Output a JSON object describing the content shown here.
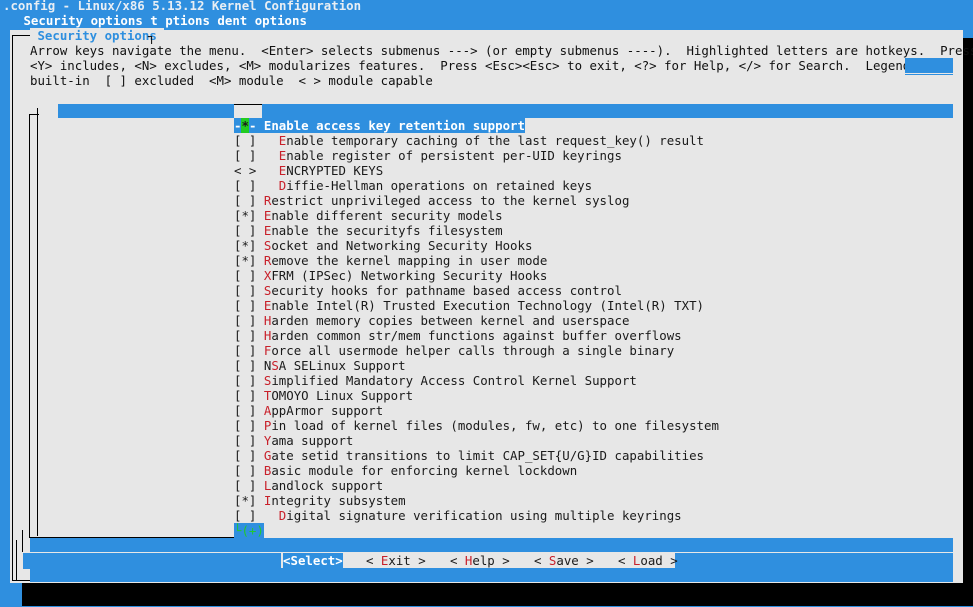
{
  "window": {
    "title": ".config - Linux/x86 5.13.12 Kernel Configuration",
    "breadcrumb": " Security options t ptions dent options"
  },
  "dialog": {
    "title": " Security options ",
    "help_line1": "Arrow keys navigate the menu.  <Enter> selects submenus ---> (or empty submenus ----).  Highlighted letters are hotkeys.  Pressing",
    "help_line2": "<Y> includes, <N> excludes, <M> modularizes features.  Press <Esc><Esc> to exit, <?> for Help, </> for Search.  Legend: [*]",
    "help_line3": "built-in  [ ] excluded  <M> module  < > module capable"
  },
  "menu": {
    "items": [
      {
        "state": "-*-",
        "hotkey": "E",
        "rest": "nable access key retention support",
        "indent": "",
        "selected": true
      },
      {
        "state": "[ ]",
        "hotkey": "E",
        "rest": "nable temporary caching of the last request_key() result",
        "indent": "  "
      },
      {
        "state": "[ ]",
        "hotkey": "E",
        "rest": "nable register of persistent per-UID keyrings",
        "indent": "  "
      },
      {
        "state": "< >",
        "hotkey": "E",
        "rest": "NCRYPTED KEYS",
        "indent": "  "
      },
      {
        "state": "[ ]",
        "hotkey": "D",
        "rest": "iffie-Hellman operations on retained keys",
        "indent": "  "
      },
      {
        "state": "[ ]",
        "hotkey": "R",
        "rest": "estrict unprivileged access to the kernel syslog",
        "indent": ""
      },
      {
        "state": "[*]",
        "hotkey": "E",
        "rest": "nable different security models",
        "indent": ""
      },
      {
        "state": "[ ]",
        "hotkey": "E",
        "rest": "nable the securityfs filesystem",
        "indent": ""
      },
      {
        "state": "[*]",
        "hotkey": "S",
        "rest": "ocket and Networking Security Hooks",
        "indent": ""
      },
      {
        "state": "[*]",
        "hotkey": "R",
        "rest": "emove the kernel mapping in user mode",
        "indent": ""
      },
      {
        "state": "[ ]",
        "hotkey": "X",
        "rest": "FRM (IPSec) Networking Security Hooks",
        "indent": ""
      },
      {
        "state": "[ ]",
        "hotkey": "S",
        "rest": "ecurity hooks for pathname based access control",
        "indent": ""
      },
      {
        "state": "[ ]",
        "hotkey": "E",
        "rest": "nable Intel(R) Trusted Execution Technology (Intel(R) TXT)",
        "indent": ""
      },
      {
        "state": "[ ]",
        "hotkey": "H",
        "rest": "arden memory copies between kernel and userspace",
        "indent": ""
      },
      {
        "state": "[ ]",
        "hotkey": "H",
        "rest": "arden common str/mem functions against buffer overflows",
        "indent": ""
      },
      {
        "state": "[ ]",
        "hotkey": "F",
        "rest": "orce all usermode helper calls through a single binary",
        "indent": ""
      },
      {
        "state": "[ ]",
        "pre": "N",
        "hotkey": "S",
        "rest": "A SELinux Support",
        "indent": ""
      },
      {
        "state": "[ ]",
        "hotkey": "S",
        "rest": "implified Mandatory Access Control Kernel Support",
        "indent": ""
      },
      {
        "state": "[ ]",
        "hotkey": "T",
        "rest": "OMOYO Linux Support",
        "indent": ""
      },
      {
        "state": "[ ]",
        "hotkey": "A",
        "rest": "ppArmor support",
        "indent": ""
      },
      {
        "state": "[ ]",
        "hotkey": "P",
        "rest": "in load of kernel files (modules, fw, etc) to one filesystem",
        "indent": ""
      },
      {
        "state": "[ ]",
        "hotkey": "Y",
        "rest": "ama support",
        "indent": ""
      },
      {
        "state": "[ ]",
        "hotkey": "G",
        "rest": "ate setid transitions to limit CAP_SET{U/G}ID capabilities",
        "indent": ""
      },
      {
        "state": "[ ]",
        "hotkey": "B",
        "rest": "asic module for enforcing kernel lockdown",
        "indent": ""
      },
      {
        "state": "[ ]",
        "hotkey": "L",
        "rest": "andlock support",
        "indent": ""
      },
      {
        "state": "[*]",
        "hotkey": "I",
        "rest": "ntegrity subsystem",
        "indent": ""
      },
      {
        "state": "[ ]",
        "hotkey": "D",
        "rest": "igital signature verification using multiple keyrings",
        "indent": "  "
      }
    ],
    "more_indicator": "└(+)"
  },
  "buttons": [
    {
      "pre": "<",
      "hotkey": "S",
      "post": "elect>",
      "selected": true
    },
    {
      "pre": "< ",
      "hotkey": "E",
      "post": "xit >"
    },
    {
      "pre": "< ",
      "hotkey": "H",
      "post": "elp >"
    },
    {
      "pre": "< ",
      "hotkey": "S",
      "post": "ave >"
    },
    {
      "pre": "< ",
      "hotkey": "L",
      "post": "oad >"
    }
  ],
  "colors": {
    "background": "#2f8fdf",
    "dialog": "#e7e7e7",
    "hotkey": "#c8202a",
    "highlight": "#2f8fdf",
    "scroll_indicator": "#21c832"
  }
}
